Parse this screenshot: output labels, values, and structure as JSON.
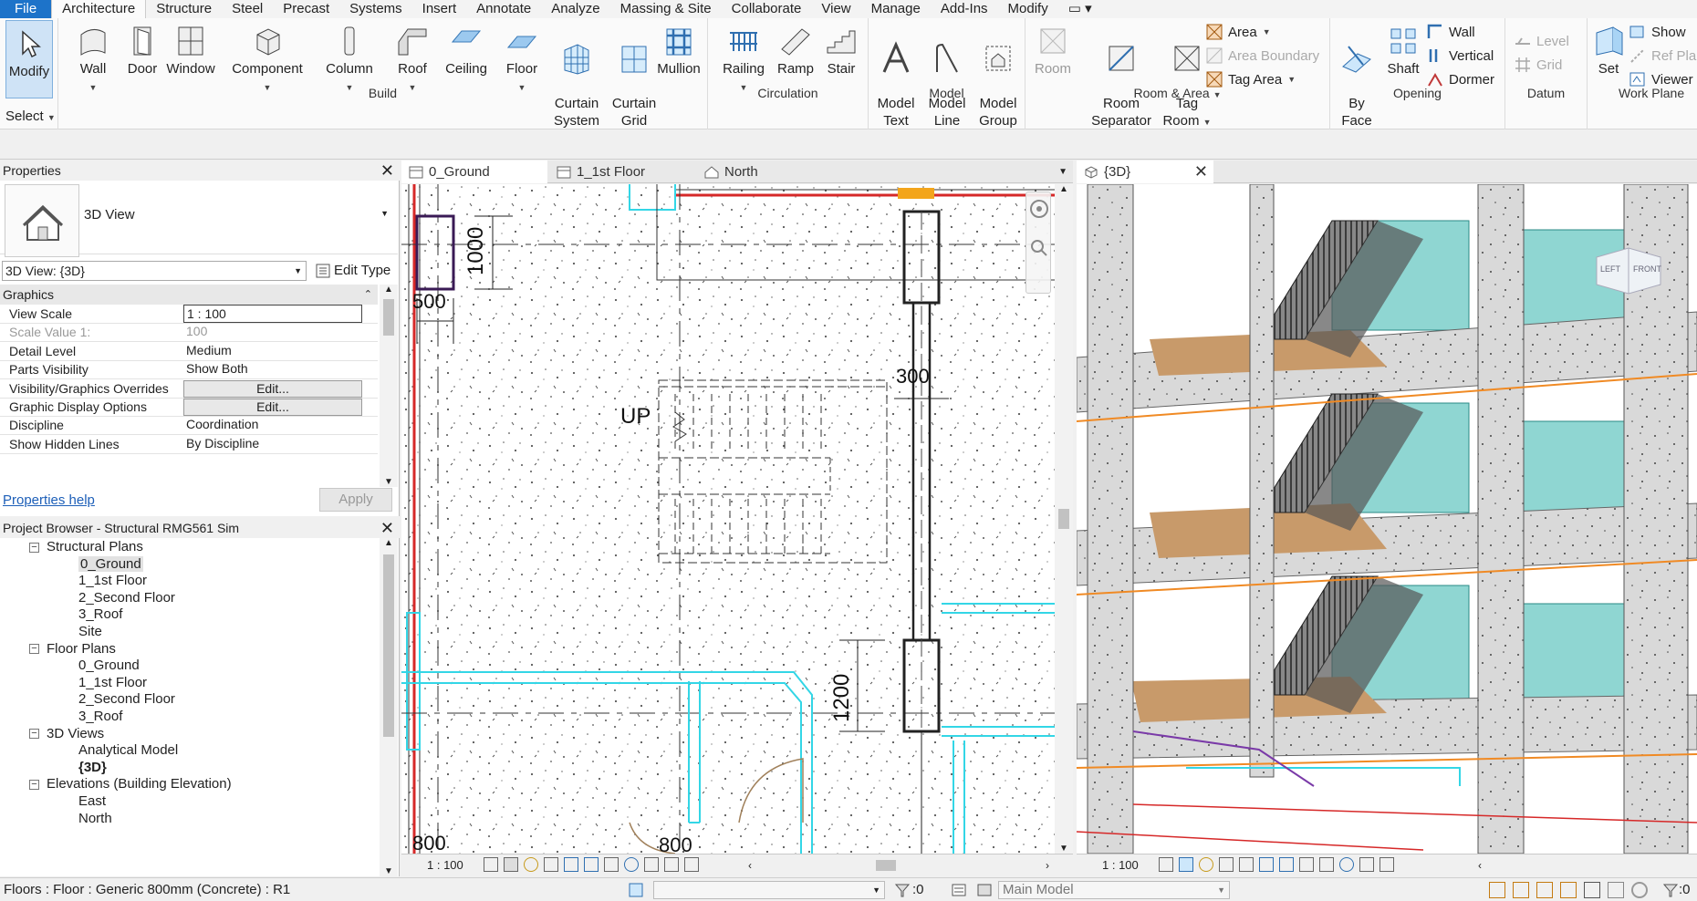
{
  "menu": {
    "tabs": [
      "File",
      "Architecture",
      "Structure",
      "Steel",
      "Precast",
      "Systems",
      "Insert",
      "Annotate",
      "Analyze",
      "Massing & Site",
      "Collaborate",
      "View",
      "Manage",
      "Add-Ins",
      "Modify"
    ]
  },
  "ribbon": {
    "select": {
      "modify": "Modify",
      "label": "Select"
    },
    "build": {
      "label": "Build",
      "wall": "Wall",
      "door": "Door",
      "window": "Window",
      "component": "Component",
      "column": "Column",
      "roof": "Roof",
      "ceiling": "Ceiling",
      "floor": "Floor",
      "curtain_system": "Curtain\nSystem",
      "curtain_grid": "Curtain\nGrid",
      "mullion": "Mullion"
    },
    "circulation": {
      "label": "Circulation",
      "railing": "Railing",
      "ramp": "Ramp",
      "stair": "Stair"
    },
    "model": {
      "label": "Model",
      "model_text": "Model\nText",
      "model_line": "Model\nLine",
      "model_group": "Model\nGroup"
    },
    "room_area": {
      "label": "Room & Area",
      "room": "Room",
      "room_separator": "Room\nSeparator",
      "tag_room": "Tag\nRoom",
      "area": "Area",
      "area_boundary": "Area  Boundary",
      "tag_area": "Tag   Area"
    },
    "opening": {
      "label": "Opening",
      "by_face": "By\nFace",
      "shaft": "Shaft",
      "wall": "Wall",
      "vertical": "Vertical",
      "dormer": "Dormer"
    },
    "datum": {
      "label": "Datum",
      "level": "Level",
      "grid": "Grid"
    },
    "work_plane": {
      "label": "Work Plane",
      "set": "Set",
      "show": "Show",
      "ref_plane": "Ref  Pla",
      "viewer": "Viewer"
    }
  },
  "properties": {
    "title": "Properties",
    "type_name": "3D View",
    "instance_selector": "3D View: {3D}",
    "edit_type": "Edit Type",
    "section": "Graphics",
    "rows": [
      {
        "key": "View Scale",
        "value": "1 : 100",
        "style": "box"
      },
      {
        "key": "Scale Value    1:",
        "value": "100",
        "style": "dim"
      },
      {
        "key": "Detail Level",
        "value": "Medium",
        "style": "plain"
      },
      {
        "key": "Parts Visibility",
        "value": "Show Both",
        "style": "plain"
      },
      {
        "key": "Visibility/Graphics Overrides",
        "value": "Edit...",
        "style": "btn"
      },
      {
        "key": "Graphic Display Options",
        "value": "Edit...",
        "style": "btn"
      },
      {
        "key": "Discipline",
        "value": "Coordination",
        "style": "plain"
      },
      {
        "key": "Show Hidden Lines",
        "value": "By Discipline",
        "style": "plain"
      }
    ],
    "help": "Properties help",
    "apply": "Apply"
  },
  "browser": {
    "title": "Project Browser - Structural RMG561 Sim",
    "nodes": [
      {
        "level": 1,
        "label": "Structural Plans",
        "toggle": "−"
      },
      {
        "level": 2,
        "label": "0_Ground",
        "selected": true
      },
      {
        "level": 2,
        "label": "1_1st Floor"
      },
      {
        "level": 2,
        "label": "2_Second Floor"
      },
      {
        "level": 2,
        "label": "3_Roof"
      },
      {
        "level": 2,
        "label": "Site"
      },
      {
        "level": 1,
        "label": "Floor Plans",
        "toggle": "−"
      },
      {
        "level": 2,
        "label": "0_Ground"
      },
      {
        "level": 2,
        "label": "1_1st Floor"
      },
      {
        "level": 2,
        "label": "2_Second Floor"
      },
      {
        "level": 2,
        "label": "3_Roof"
      },
      {
        "level": 1,
        "label": "3D Views",
        "toggle": "−"
      },
      {
        "level": 2,
        "label": "Analytical Model"
      },
      {
        "level": 2,
        "label": "{3D}",
        "bold": true
      },
      {
        "level": 1,
        "label": "Elevations (Building Elevation)",
        "toggle": "−"
      },
      {
        "level": 2,
        "label": "East"
      },
      {
        "level": 2,
        "label": "North"
      }
    ]
  },
  "plan_view": {
    "tabs": [
      "0_Ground",
      "1_1st Floor",
      "North"
    ],
    "dims": {
      "d1000": "1000",
      "d500": "500",
      "d300": "300",
      "d1200": "1200",
      "d800a": "800",
      "d800b": "800",
      "up": "UP"
    },
    "scale": "1 : 100"
  },
  "view3d": {
    "tab": "{3D}",
    "scale": "1 : 100",
    "cube_left": "LEFT",
    "cube_front": "FRONT"
  },
  "status": {
    "message": "Floors : Floor : Generic 800mm (Concrete) : R1",
    "zero": ":0",
    "workset": "Main Model",
    "filter": ":0"
  },
  "colors": {
    "accent": "#1d73c9",
    "glass": "#7fd3d0",
    "slab": "#d9d9d9",
    "orange": "#f08a24",
    "cyan": "#33d6e6",
    "red": "#d62828"
  }
}
